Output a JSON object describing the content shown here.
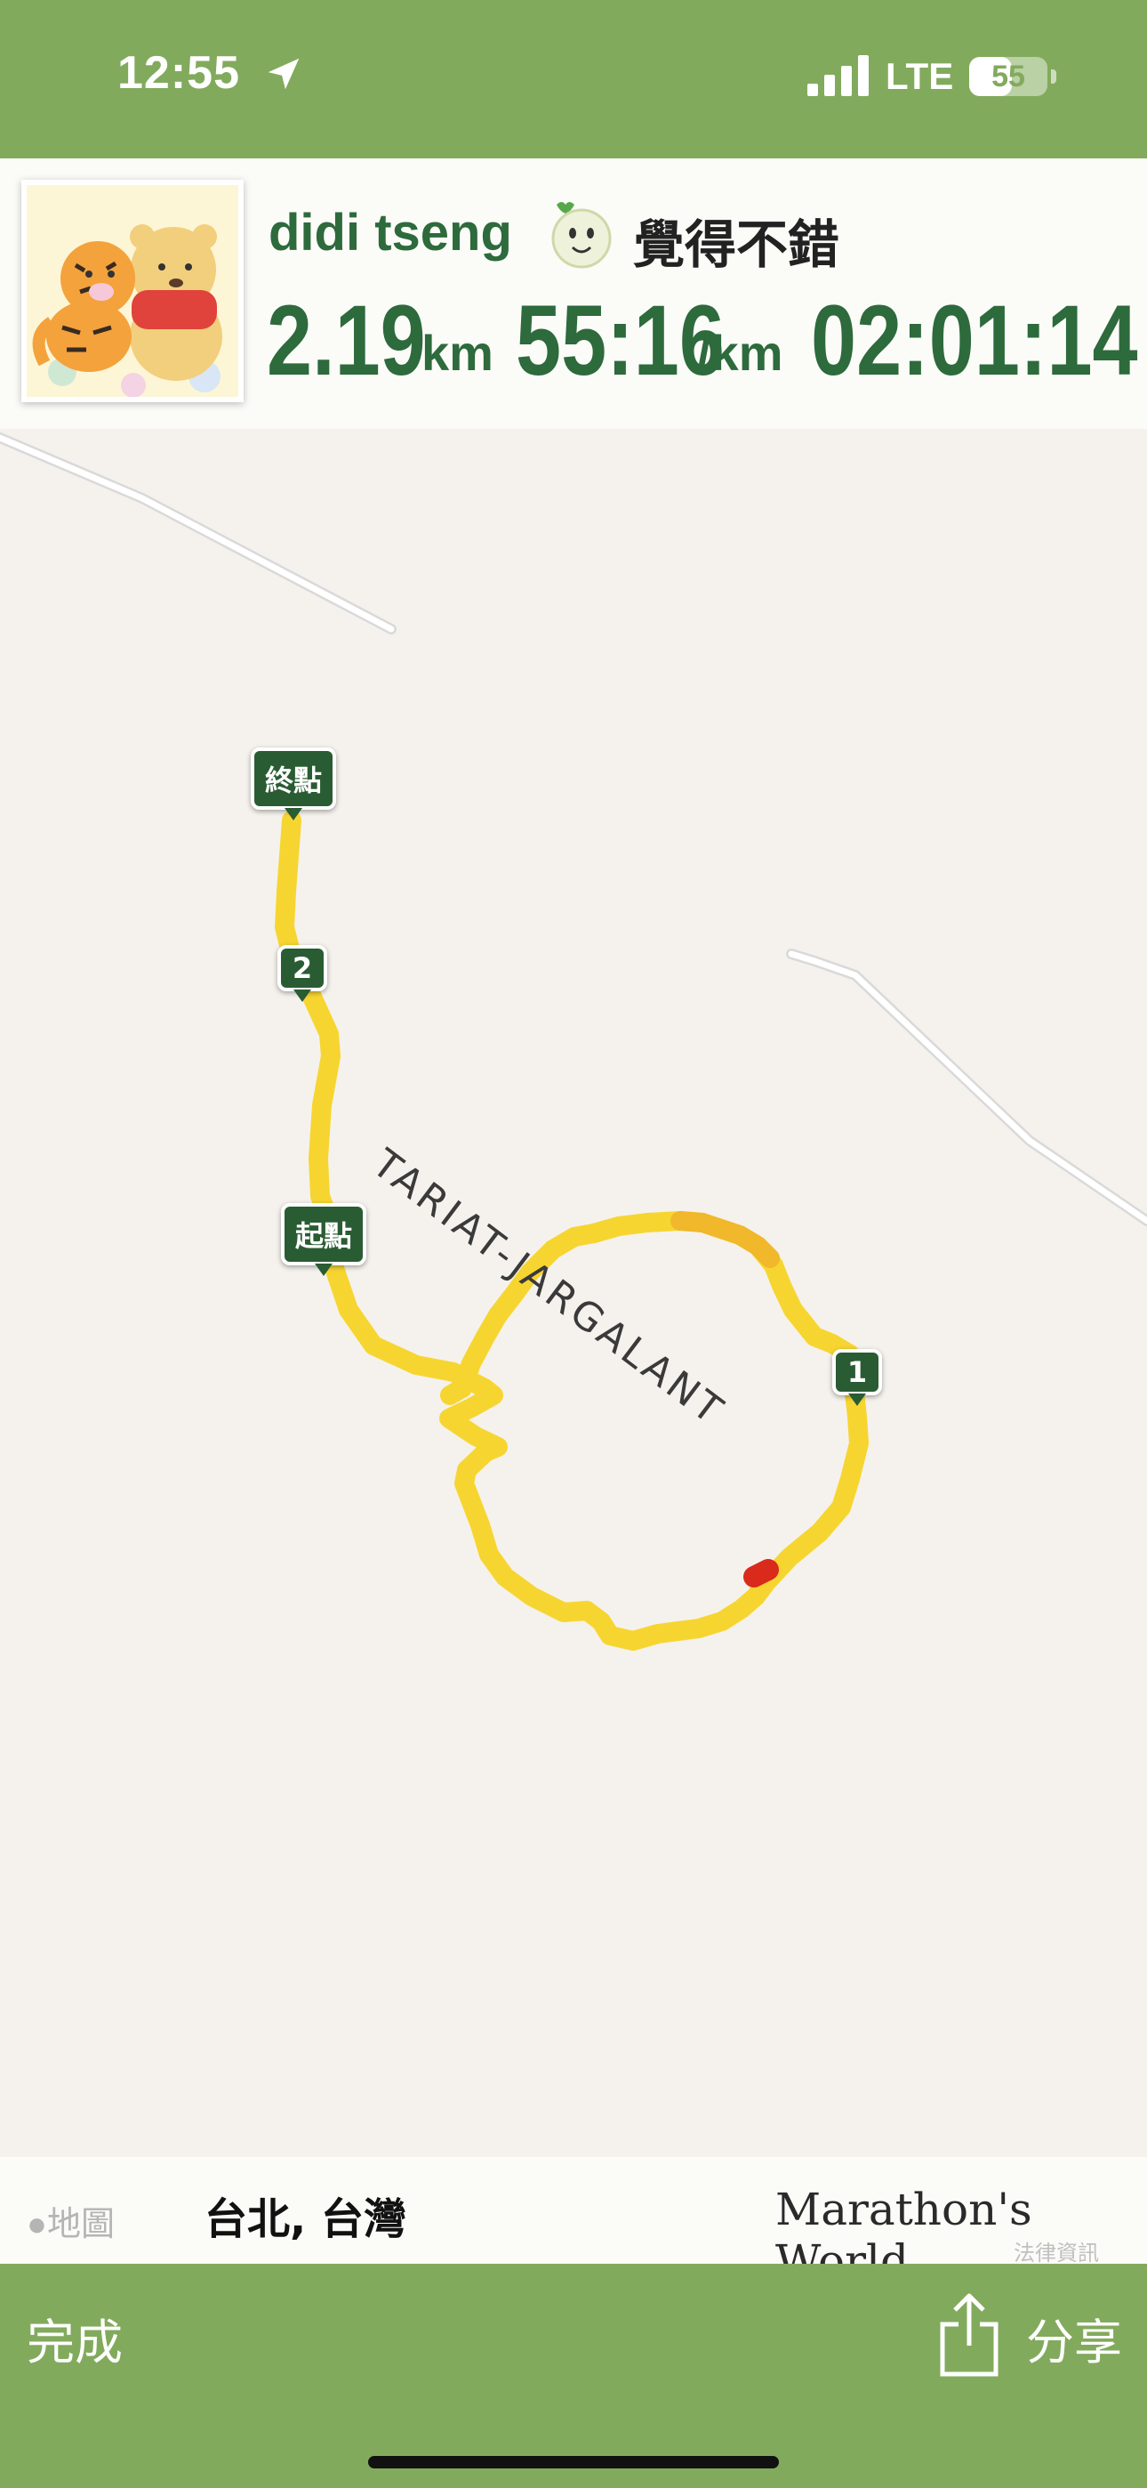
{
  "status_bar": {
    "time": "12:55",
    "network": "LTE",
    "battery_level": "55",
    "battery_fraction": 0.55,
    "icons": [
      "location-arrow-icon",
      "signal-icon",
      "battery-icon"
    ]
  },
  "header": {
    "user_name": "didi tseng",
    "mood_text": "覺得不錯",
    "mood_icon": "smiley-face-icon",
    "distance": "2.19",
    "distance_unit": "km",
    "pace": "55:16",
    "pace_unit": "/km",
    "duration": "02:01:14"
  },
  "map": {
    "road_name": "TARIAT-JARGALANT",
    "markers": {
      "finish": "終點",
      "start": "起點",
      "km2": "2",
      "km1": "1"
    },
    "colors": {
      "route": "#f7d531",
      "route_fast": "#f0b82a",
      "route_hot": "#d92a1c",
      "marker": "#2a5c33",
      "road": "#ffffff"
    }
  },
  "map_footer": {
    "maps_attribution": "地圖",
    "location": "台北, 台灣",
    "brand": "Marathon's World",
    "legal": "法律資訊"
  },
  "bottom_bar": {
    "done_label": "完成",
    "share_label": "分享",
    "share_icon": "share-icon"
  },
  "theme": {
    "bar_green": "#82aa5c",
    "text_green": "#2d6a3c"
  }
}
